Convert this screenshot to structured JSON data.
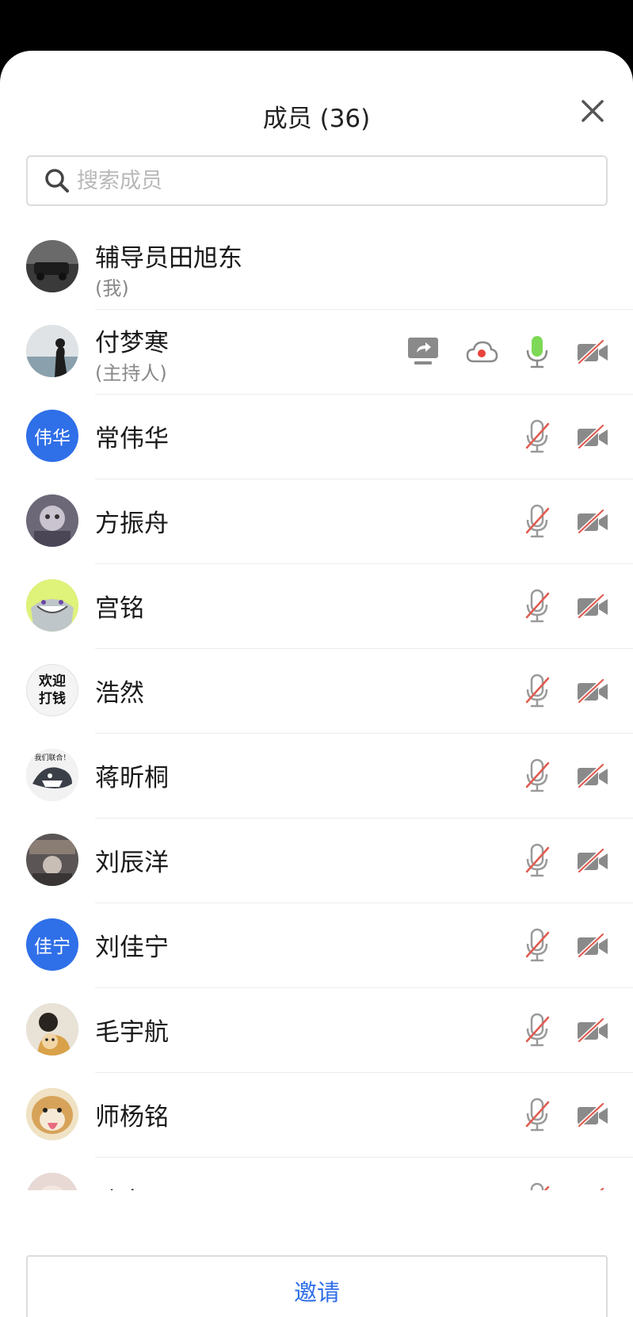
{
  "header": {
    "title": "成员 (36)"
  },
  "search": {
    "placeholder": "搜索成员",
    "value": ""
  },
  "members": [
    {
      "name": "辅导员田旭东",
      "sub": "(我)",
      "avatar": "photo",
      "icons": []
    },
    {
      "name": "付梦寒",
      "sub": "(主持人)",
      "avatar": "photo",
      "icons": [
        "screen-share-icon",
        "cloud-record-icon",
        "mic-on-icon",
        "camera-off-icon"
      ]
    },
    {
      "name": "常伟华",
      "avatar": "initials",
      "initials": "伟华",
      "icons": [
        "mic-off-icon",
        "camera-off-icon"
      ]
    },
    {
      "name": "方振舟",
      "avatar": "photo",
      "icons": [
        "mic-off-icon",
        "camera-off-icon"
      ]
    },
    {
      "name": "宫铭",
      "avatar": "photo",
      "icons": [
        "mic-off-icon",
        "camera-off-icon"
      ]
    },
    {
      "name": "浩然",
      "avatar": "text",
      "avatar_text": "欢迎打钱",
      "icons": [
        "mic-off-icon",
        "camera-off-icon"
      ]
    },
    {
      "name": "蒋昕桐",
      "avatar": "photo",
      "avatar_text": "我们联合！",
      "icons": [
        "mic-off-icon",
        "camera-off-icon"
      ]
    },
    {
      "name": "刘辰洋",
      "avatar": "photo",
      "icons": [
        "mic-off-icon",
        "camera-off-icon"
      ]
    },
    {
      "name": "刘佳宁",
      "avatar": "initials",
      "initials": "佳宁",
      "icons": [
        "mic-off-icon",
        "camera-off-icon"
      ]
    },
    {
      "name": "毛宇航",
      "avatar": "photo",
      "icons": [
        "mic-off-icon",
        "camera-off-icon"
      ]
    },
    {
      "name": "师杨铭",
      "avatar": "photo",
      "icons": [
        "mic-off-icon",
        "camera-off-icon"
      ]
    },
    {
      "name": "孙康环",
      "avatar": "photo",
      "icons": [
        "mic-off-icon",
        "camera-off-icon"
      ]
    }
  ],
  "footer": {
    "invite_label": "邀请"
  },
  "colors": {
    "accent": "#2f6fe8",
    "mic_on": "#7ed957",
    "mute_slash": "#e05a4f",
    "icon_gray": "#8a8a8a"
  }
}
